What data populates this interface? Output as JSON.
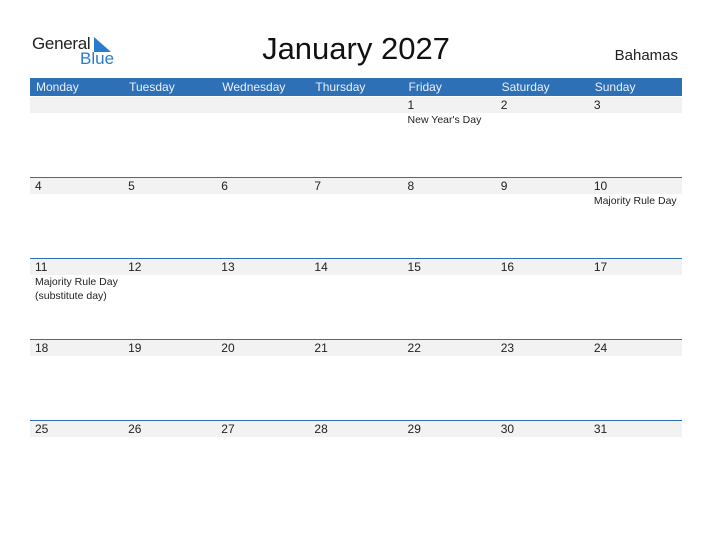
{
  "logo": {
    "general": "General",
    "blue": "Blue",
    "accent_color": "#2a7bd0"
  },
  "title": "January 2027",
  "country": "Bahamas",
  "colors": {
    "header_bg": "#2e70b5",
    "strip_bg": "#f2f2f2"
  },
  "weekdays": [
    "Monday",
    "Tuesday",
    "Wednesday",
    "Thursday",
    "Friday",
    "Saturday",
    "Sunday"
  ],
  "weeks": [
    {
      "days": [
        {
          "num": "",
          "event": ""
        },
        {
          "num": "",
          "event": ""
        },
        {
          "num": "",
          "event": ""
        },
        {
          "num": "",
          "event": ""
        },
        {
          "num": "1",
          "event": "New Year's Day"
        },
        {
          "num": "2",
          "event": ""
        },
        {
          "num": "3",
          "event": ""
        }
      ]
    },
    {
      "days": [
        {
          "num": "4",
          "event": ""
        },
        {
          "num": "5",
          "event": ""
        },
        {
          "num": "6",
          "event": ""
        },
        {
          "num": "7",
          "event": ""
        },
        {
          "num": "8",
          "event": ""
        },
        {
          "num": "9",
          "event": ""
        },
        {
          "num": "10",
          "event": "Majority Rule Day"
        }
      ]
    },
    {
      "days": [
        {
          "num": "11",
          "event": "Majority Rule Day (substitute day)"
        },
        {
          "num": "12",
          "event": ""
        },
        {
          "num": "13",
          "event": ""
        },
        {
          "num": "14",
          "event": ""
        },
        {
          "num": "15",
          "event": ""
        },
        {
          "num": "16",
          "event": ""
        },
        {
          "num": "17",
          "event": ""
        }
      ]
    },
    {
      "days": [
        {
          "num": "18",
          "event": ""
        },
        {
          "num": "19",
          "event": ""
        },
        {
          "num": "20",
          "event": ""
        },
        {
          "num": "21",
          "event": ""
        },
        {
          "num": "22",
          "event": ""
        },
        {
          "num": "23",
          "event": ""
        },
        {
          "num": "24",
          "event": ""
        }
      ]
    },
    {
      "days": [
        {
          "num": "25",
          "event": ""
        },
        {
          "num": "26",
          "event": ""
        },
        {
          "num": "27",
          "event": ""
        },
        {
          "num": "28",
          "event": ""
        },
        {
          "num": "29",
          "event": ""
        },
        {
          "num": "30",
          "event": ""
        },
        {
          "num": "31",
          "event": ""
        }
      ]
    }
  ]
}
